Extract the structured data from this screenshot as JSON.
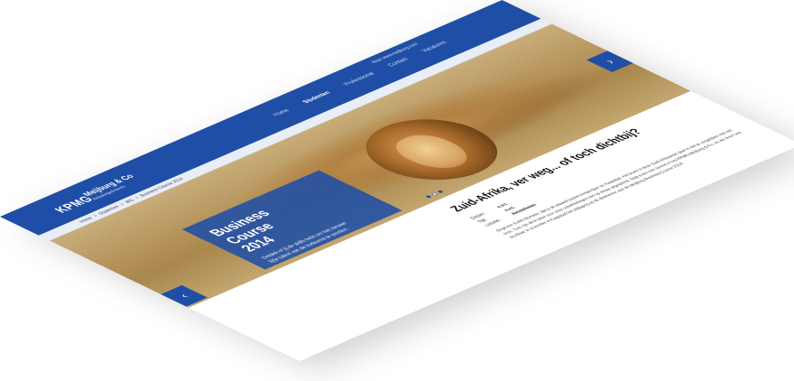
{
  "header": {
    "logo": "KPMG",
    "brand_name": "Meijburg & Co",
    "brand_tag": "Belastingadviseurs",
    "toplinks": "Naar www.meijburg.com",
    "nav": [
      {
        "label": "Home",
        "active": false
      },
      {
        "label": "Studenten",
        "active": true
      },
      {
        "label": "Professional",
        "active": false
      },
      {
        "label": "Contact",
        "active": false
      },
      {
        "label": "Vacatures",
        "active": false
      }
    ]
  },
  "breadcrumb": [
    "Home",
    ">",
    "Studenten",
    ">",
    "WG",
    ">",
    "Business Course 2014"
  ],
  "hero": {
    "title": "Business Course 2014",
    "text": "Ontdek of jij de skills hebt om het nieuwe lijfje talent van de toekomst te worden.",
    "prev_icon": "‹",
    "next_icon": "›",
    "slides_count": 3,
    "current_slide": 2
  },
  "article": {
    "title": "Zuid-Afrika, ver weg... of toch dichtbij?",
    "meta": [
      {
        "label": "Datum:",
        "value": "n.v.t."
      },
      {
        "label": "Tijd:",
        "value": "n.v.t."
      },
      {
        "label": "Locatie:",
        "value": "Amstelveen"
      }
    ],
    "body": "Ongeveer 9.400 kilometer, dat is de afstand tussen Amsterdam en Kaapstad. Het leven in deze Zuid-Afrikaanse stad is niet te vergelijken met het onze. Toch zijn deze twee voor onze ontwikkelingen niet op elkaar afgestemd. Stap even over kennis in het KPMG-Meijburg & Co, en we leren ons bij elkaar in november in Kaapstad het uitdaging op de deelnemer aan de Meijburg Business Course 2014!"
  },
  "colors": {
    "brand_blue": "#1f4ea6",
    "light_band": "#e9eef6"
  }
}
